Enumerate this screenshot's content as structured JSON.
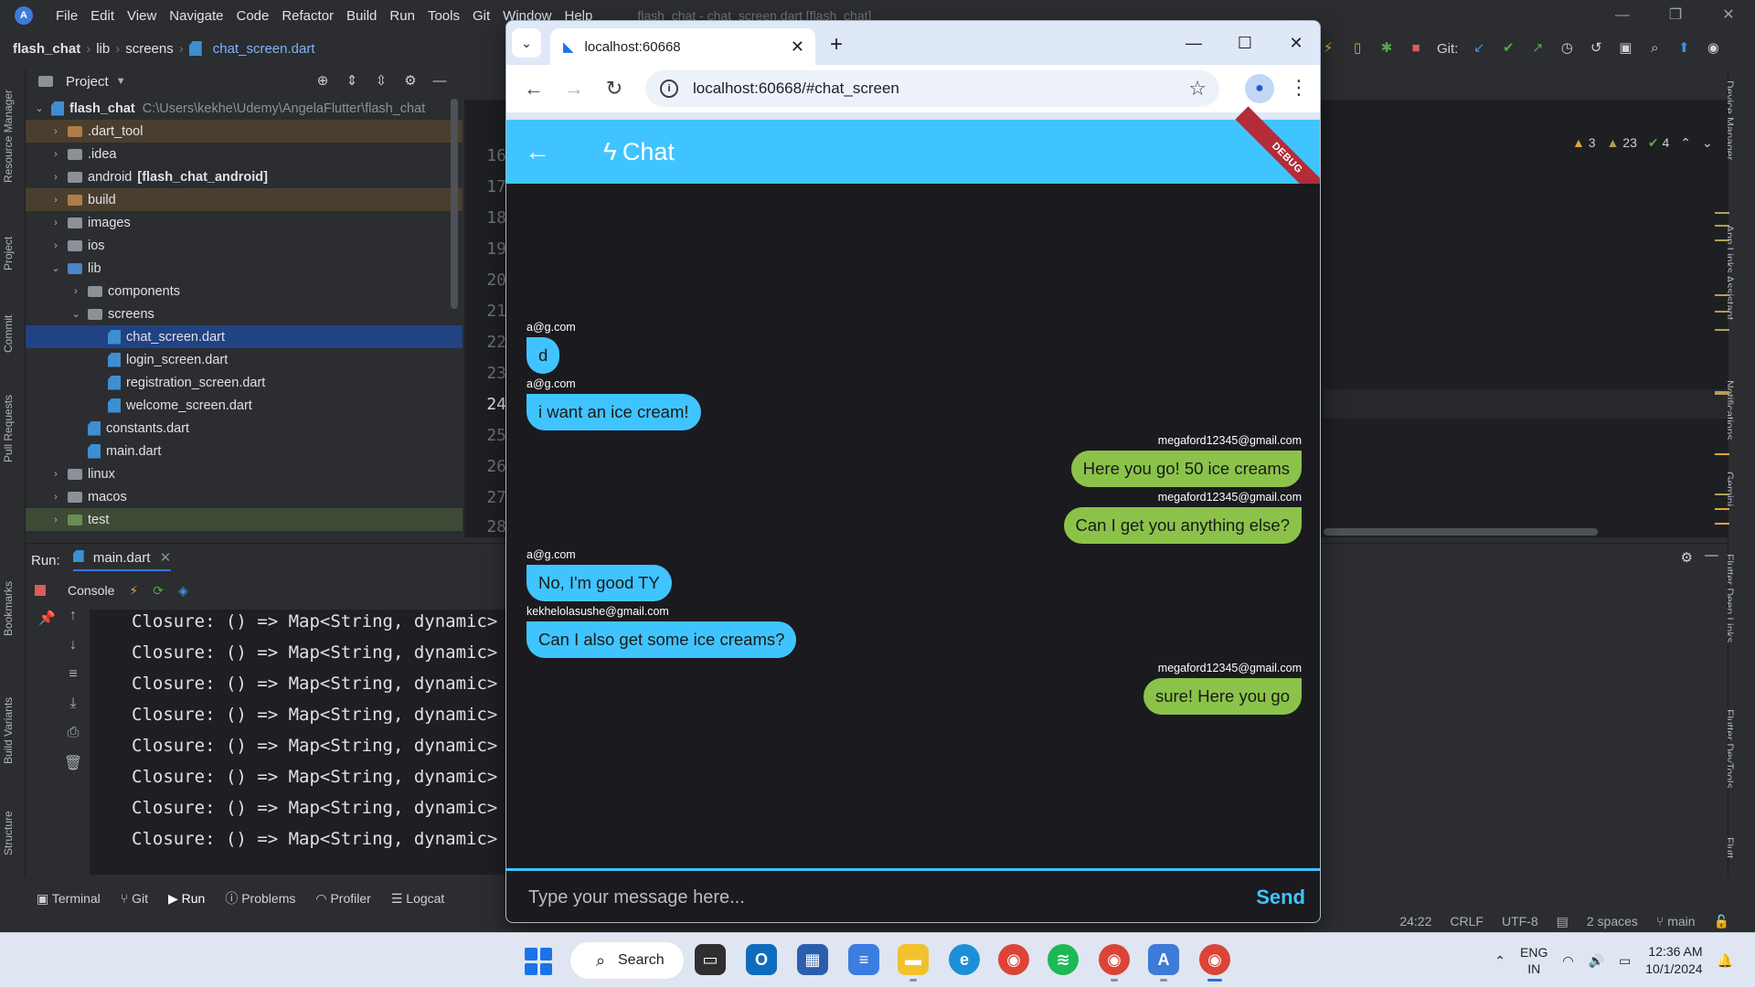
{
  "ide": {
    "menu": [
      "File",
      "Edit",
      "View",
      "Navigate",
      "Code",
      "Refactor",
      "Build",
      "Run",
      "Tools",
      "Git",
      "Window",
      "Help"
    ],
    "window_title": "flash_chat - chat_screen.dart [flash_chat]",
    "breadcrumb": [
      "flash_chat",
      "lib",
      "screens",
      "chat_screen.dart"
    ],
    "git_label": "Git:",
    "project_panel": {
      "title": "Project",
      "rows": [
        {
          "label": "flash_chat",
          "suffix": "C:\\Users\\kekhe\\Udemy\\AngelaFlutter\\flash_chat"
        },
        {
          "label": ".dart_tool"
        },
        {
          "label": ".idea"
        },
        {
          "label": "android",
          "suffix": "[flash_chat_android]"
        },
        {
          "label": "build"
        },
        {
          "label": "images"
        },
        {
          "label": "ios"
        },
        {
          "label": "lib"
        },
        {
          "label": "components"
        },
        {
          "label": "screens"
        },
        {
          "label": "chat_screen.dart"
        },
        {
          "label": "login_screen.dart"
        },
        {
          "label": "registration_screen.dart"
        },
        {
          "label": "welcome_screen.dart"
        },
        {
          "label": "constants.dart"
        },
        {
          "label": "main.dart"
        },
        {
          "label": "linux"
        },
        {
          "label": "macos"
        },
        {
          "label": "test"
        }
      ]
    },
    "line_numbers": [
      "16",
      "17",
      "18",
      "19",
      "20",
      "21",
      "22",
      "23",
      "24",
      "25",
      "26",
      "27",
      "28"
    ],
    "current_line": "24",
    "inspections": {
      "warnings": "3",
      "weak_warnings": "23",
      "ok": "4"
    },
    "run_panel": {
      "label": "Run:",
      "tab": "main.dart",
      "console_tab": "Console",
      "lines": [
        "Closure: () => Map<String, dynamic> f",
        "Closure: () => Map<String, dynamic> f",
        "Closure: () => Map<String, dynamic> f",
        "Closure: () => Map<String, dynamic> f",
        "Closure: () => Map<String, dynamic> f",
        "Closure: () => Map<String, dynamic> f",
        "Closure: () => Map<String, dynamic> f",
        "Closure: () => Map<String, dynamic> f"
      ]
    },
    "bottom_tools": [
      "Terminal",
      "Git",
      "Run",
      "Problems",
      "Profiler",
      "Logcat"
    ],
    "status": {
      "position": "24:22",
      "line_ending": "CRLF",
      "encoding": "UTF-8",
      "indent": "2 spaces",
      "branch": "main"
    },
    "left_strip": [
      "Resource Manager",
      "Project",
      "Commit",
      "Pull Requests",
      "Bookmarks",
      "Build Variants",
      "Structure"
    ],
    "right_strip": [
      "Device Manager",
      "App Links Assistant",
      "Notifications",
      "Gemini",
      "Flutter Deep Links",
      "Flutter DevTools",
      "Flutt"
    ]
  },
  "browser": {
    "tab_title": "localhost:60668",
    "url": "localhost:60668/#chat_screen"
  },
  "app": {
    "title": "Chat",
    "debug_banner": "DEBUG",
    "messages": [
      {
        "sender": "a@g.com",
        "text": "d",
        "side": "left"
      },
      {
        "sender": "a@g.com",
        "text": "i want an ice cream!",
        "side": "left"
      },
      {
        "sender": "megaford12345@gmail.com",
        "text": "Here you go! 50 ice creams",
        "side": "right"
      },
      {
        "sender": "megaford12345@gmail.com",
        "text": "Can I get you anything else?",
        "side": "right"
      },
      {
        "sender": "a@g.com",
        "text": "No, I'm good TY",
        "side": "left"
      },
      {
        "sender": "kekhelolasushe@gmail.com",
        "text": "Can I also get some ice creams?",
        "side": "left"
      },
      {
        "sender": "megaford12345@gmail.com",
        "text": "sure! Here you go",
        "side": "right"
      }
    ],
    "input_placeholder": "Type your message here...",
    "send_label": "Send",
    "colors": {
      "accent": "#40c4ff",
      "own_bubble": "#8bc34a",
      "background": "#1a1a1f"
    }
  },
  "taskbar": {
    "search_label": "Search",
    "tray": {
      "lang_top": "ENG",
      "lang_bottom": "IN",
      "time": "12:36 AM",
      "date": "10/1/2024"
    }
  }
}
